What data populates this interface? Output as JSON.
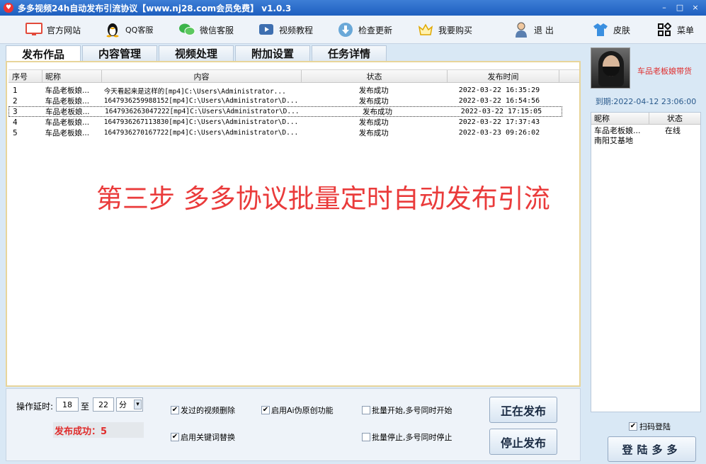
{
  "window": {
    "title": "多多视频24h自动发布引流协议【www.nj28.com会员免费】 v1.0.3",
    "app_icon": "♥",
    "controls": {
      "minimize": "–",
      "maximize": "□",
      "close": "×"
    }
  },
  "toolbar": {
    "items": [
      {
        "label": "官方网站",
        "icon": "monitor-icon"
      },
      {
        "label": "QQ客服",
        "icon": "qq-penguin-icon"
      },
      {
        "label": "微信客服",
        "icon": "wechat-icon"
      },
      {
        "label": "视频教程",
        "icon": "video-play-icon"
      },
      {
        "label": "检查更新",
        "icon": "download-icon"
      },
      {
        "label": "我要购买",
        "icon": "crown-icon"
      },
      {
        "label": "退 出",
        "icon": "user-exit-icon"
      },
      {
        "label": "皮肤",
        "icon": "shirt-icon"
      },
      {
        "label": "菜单",
        "icon": "grid-menu-icon"
      }
    ]
  },
  "tabs": [
    "发布作品",
    "内容管理",
    "视频处理",
    "附加设置",
    "任务详情"
  ],
  "grid": {
    "columns": [
      "序号",
      "昵称",
      "内容",
      "状态",
      "发布时间"
    ],
    "rows": [
      [
        "1",
        "车品老板娘...",
        "今天看起来是这样的[mp4]C:\\Users\\Administrator...",
        "发布成功",
        "2022-03-22 16:35:29"
      ],
      [
        "2",
        "车品老板娘...",
        "1647936259988152[mp4]C:\\Users\\Administrator\\D...",
        "发布成功",
        "2022-03-22 16:54:56"
      ],
      [
        "3",
        "车品老板娘...",
        "1647936263047222[mp4]C:\\Users\\Administrator\\D...",
        "发布成功",
        "2022-03-22 17:15:05"
      ],
      [
        "4",
        "车品老板娘...",
        "1647936267113830[mp4]C:\\Users\\Administrator\\D...",
        "发布成功",
        "2022-03-22 17:37:43"
      ],
      [
        "5",
        "车品老板娘...",
        "1647936270167722[mp4]C:\\Users\\Administrator\\D...",
        "发布成功",
        "2022-03-23 09:26:02"
      ]
    ]
  },
  "overlay_text": "第三步 多多协议批量定时自动发布引流",
  "settings": {
    "delay_label": "操作延时:",
    "delay_from": "18",
    "to_label": "至",
    "delay_to": "22",
    "unit": "分",
    "dropdown_arrow": "▾",
    "success_text": "发布成功：5",
    "checkboxes": [
      {
        "label": "发过的视频删除",
        "checked": true
      },
      {
        "label": "启用Ai伪原创功能",
        "checked": true
      },
      {
        "label": "批量开始,多号同时开始",
        "checked": false
      },
      {
        "label": "启用关键词替换",
        "checked": true
      },
      {
        "label": "批量停止,多号同时停止",
        "checked": false
      }
    ],
    "check_mark": "✔",
    "publishing_button": "正在发布",
    "stop_button": "停止发布"
  },
  "side": {
    "shop_name": "车品老板娘带货",
    "expire": "到期:2022-04-12 23:06:00",
    "list_columns": [
      "昵称",
      "状态"
    ],
    "accounts": [
      {
        "name": "车品老板娘...",
        "status": "在线"
      },
      {
        "name": "南阳艾基地",
        "status": ""
      }
    ],
    "scan_login_label": "扫码登陆",
    "scan_login_checked": true,
    "login_button": "登陆多多"
  },
  "colors": {
    "accent_red": "#e02c2c",
    "titlebar": "#1e5fbf",
    "panel_border": "#e8d59a"
  }
}
